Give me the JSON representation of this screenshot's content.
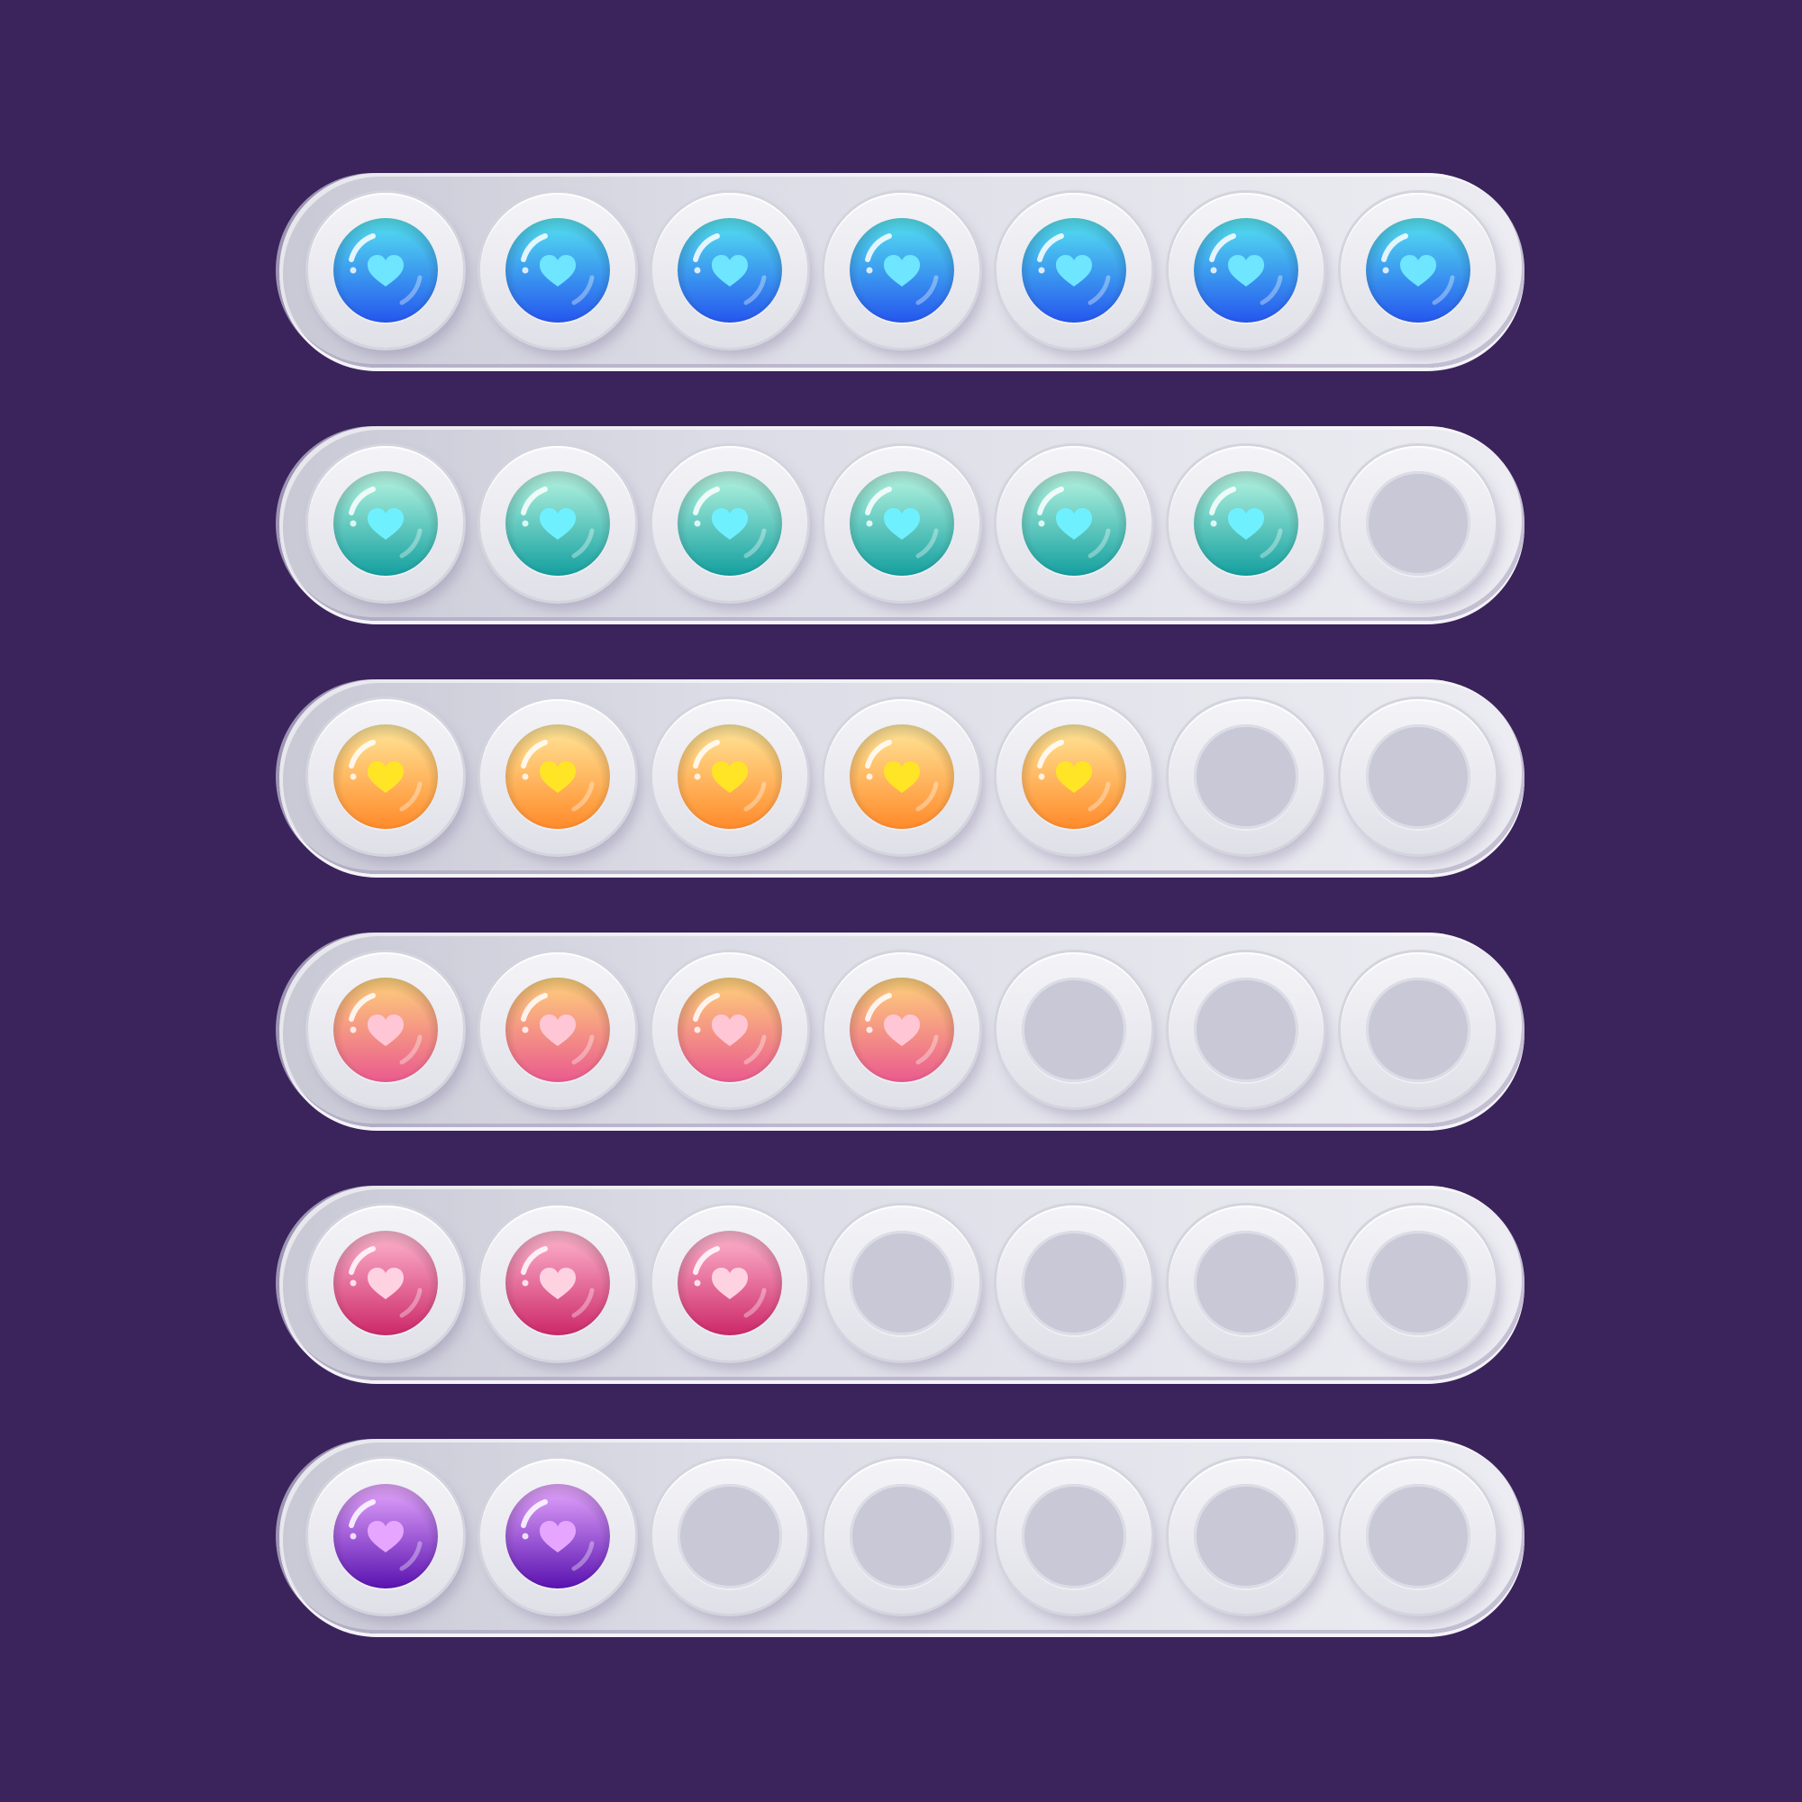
{
  "screen": {
    "background": "#3b235b"
  },
  "meters": [
    {
      "id": "blue",
      "filled": 7,
      "total": 7,
      "gem": {
        "top": "#55e4f0",
        "bottom": "#2556ee",
        "heart": "#6fe6ff",
        "name": "blue-heart-gem"
      }
    },
    {
      "id": "green",
      "filled": 6,
      "total": 7,
      "gem": {
        "top": "#b9f6e2",
        "bottom": "#139f9f",
        "heart": "#6ff0ff",
        "name": "green-heart-gem"
      }
    },
    {
      "id": "yellow",
      "filled": 5,
      "total": 7,
      "gem": {
        "top": "#ffe79a",
        "bottom": "#ff8a2a",
        "heart": "#ffe526",
        "name": "yellow-heart-gem"
      }
    },
    {
      "id": "peach",
      "filled": 4,
      "total": 7,
      "gem": {
        "top": "#ffd27a",
        "bottom": "#ea5a8e",
        "heart": "#ffc7d6",
        "name": "peach-heart-gem"
      }
    },
    {
      "id": "pink",
      "filled": 3,
      "total": 7,
      "gem": {
        "top": "#ffb7cf",
        "bottom": "#cc2868",
        "heart": "#ffd2e1",
        "name": "pink-heart-gem"
      }
    },
    {
      "id": "purple",
      "filled": 2,
      "total": 7,
      "gem": {
        "top": "#e7a8ff",
        "bottom": "#5a12b0",
        "heart": "#e6a6ff",
        "name": "purple-heart-gem"
      }
    }
  ]
}
